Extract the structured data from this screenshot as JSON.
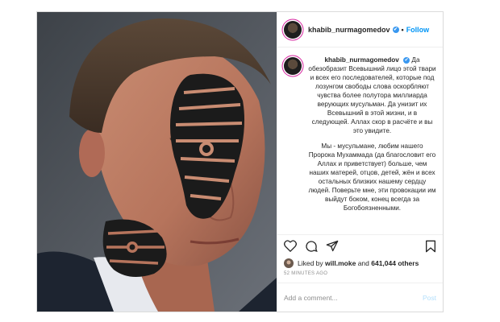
{
  "header": {
    "username": "khabib_nurmagomedov",
    "separator": "•",
    "follow_label": "Follow",
    "verified_glyph": "✔"
  },
  "caption": {
    "username": "khabib_nurmagomedov",
    "paragraph1": "Да обезобразит Всевышний лицо этой твари и всех его последователей, которые под лозунгом свободы слова оскорбляют чувства более полутора миллиарда верующих мусульман. Да унизит их Всевышний в этой жизни, и в следующей. Аллах скор в расчёте и вы это увидите.",
    "paragraph2": "Мы - мусульмане, любим нашего Пророка Мухаммада (да благословит его Аллах и приветствует) больше, чем наших матерей, отцов, детей, жён и всех остальных близких нашему сердцу людей. Поверьте мне, эти провокации им выйдут боком, конец всегда за Богобоязненными."
  },
  "likes": {
    "prefix": "Liked by",
    "user": "will.moke",
    "conjunction": "and",
    "count": "641,044 others"
  },
  "timestamp": "52 MINUTES AGO",
  "comment": {
    "placeholder": "Add a comment...",
    "post_label": "Post"
  },
  "colors": {
    "accent": "#0095f6",
    "verified": "#3897f0"
  }
}
